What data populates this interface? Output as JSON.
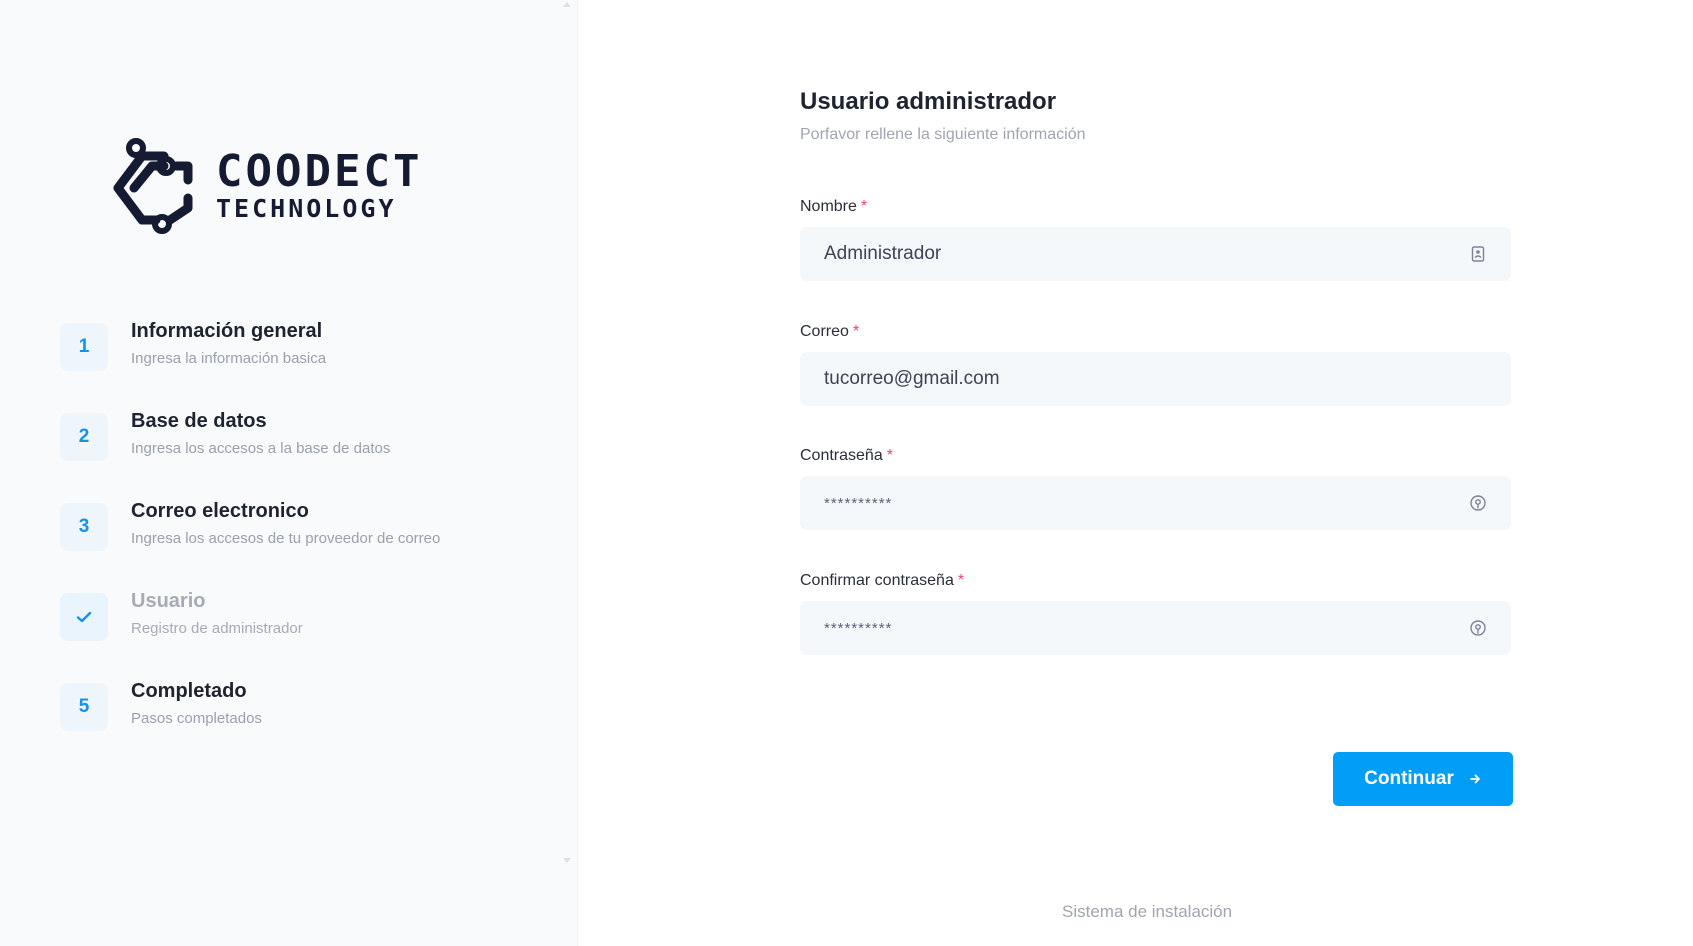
{
  "brand": {
    "name": "COODECT",
    "tagline": "TECHNOLOGY",
    "color": "#141b33"
  },
  "steps": [
    {
      "number": "1",
      "title": "Información general",
      "description": "Ingresa la información basica",
      "state": "completed"
    },
    {
      "number": "2",
      "title": "Base de datos",
      "description": "Ingresa los accesos a la base de datos",
      "state": "completed"
    },
    {
      "number": "3",
      "title": "Correo electronico",
      "description": "Ingresa los accesos de tu proveedor de correo",
      "state": "completed"
    },
    {
      "number": "",
      "title": "Usuario",
      "description": "Registro de administrador",
      "state": "current",
      "icon": "check-icon"
    },
    {
      "number": "5",
      "title": "Completado",
      "description": "Pasos completados",
      "state": "pending"
    }
  ],
  "form": {
    "title": "Usuario administrador",
    "subtitle": "Porfavor rellene la siguiente información",
    "required_marker": "*",
    "fields": {
      "nombre": {
        "label": "Nombre",
        "value": "Administrador",
        "icon": "contact-card-icon"
      },
      "correo": {
        "label": "Correo",
        "value": "tucorreo@gmail.com"
      },
      "contrasena": {
        "label": "Contraseña",
        "value": "**********",
        "icon": "fingerprint-icon"
      },
      "confirmar": {
        "label": "Confirmar contraseña",
        "value": "**********",
        "icon": "fingerprint-icon"
      }
    },
    "continue_label": "Continuar"
  },
  "footer": {
    "text": "Sistema de instalación"
  },
  "colors": {
    "accent": "#009ef7",
    "required": "#f1416c",
    "input_bg": "#f5f8fa",
    "sidebar_bg": "#f9fafb"
  }
}
